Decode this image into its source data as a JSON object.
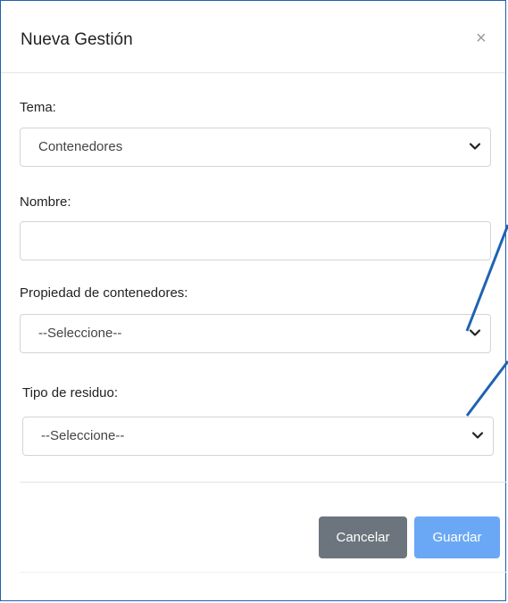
{
  "modal": {
    "title": "Nueva Gestión",
    "close_symbol": "×"
  },
  "form": {
    "tema": {
      "label": "Tema:",
      "selected": "Contenedores"
    },
    "nombre": {
      "label": "Nombre:",
      "value": "",
      "placeholder": ""
    },
    "propiedad": {
      "label": "Propiedad de contenedores:",
      "selected": "--Seleccione--"
    },
    "residuo": {
      "label": "Tipo de residuo:",
      "selected": "--Seleccione--"
    }
  },
  "footer": {
    "cancel_label": "Cancelar",
    "save_label": "Guardar"
  },
  "colors": {
    "annotation_arrow": "#1f63b0",
    "cancel_button": "#6c757d",
    "save_button": "#6aa8f5"
  },
  "icons": [
    "close-icon",
    "chevron-down-icon"
  ]
}
